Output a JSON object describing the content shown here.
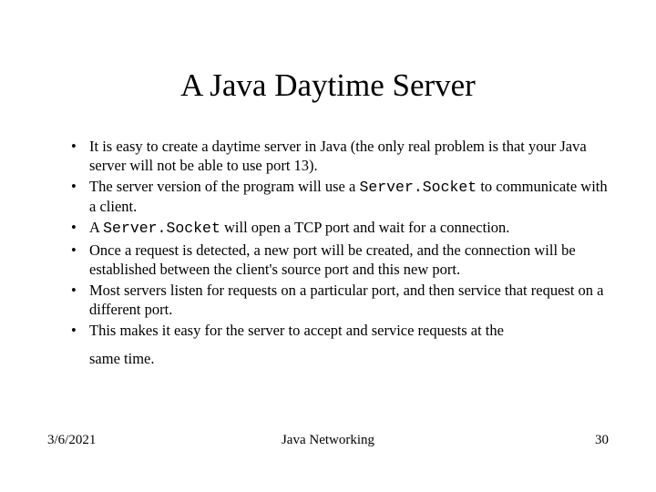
{
  "title": "A Java Daytime Server",
  "bullets": [
    {
      "pre": "It is easy to create a daytime server in Java (the only real problem is that your Java server will not be able to use port 13)."
    },
    {
      "pre": "The server version of the program will use a ",
      "code": "Server.Socket",
      "post": " to communicate with a client."
    },
    {
      "pre": "A ",
      "code": "Server.Socket",
      "post": " will open a TCP port and wait for a connection."
    },
    {
      "pre": "Once a request is detected, a new port will be created, and the connection will be established between the client's source port and this new port."
    },
    {
      "pre": "Most servers listen for requests on a particular port, and then service that request on a different port."
    },
    {
      "pre": "This makes it easy for the server to accept and service requests at the",
      "trail": "same time."
    }
  ],
  "footer": {
    "date": "3/6/2021",
    "topic": "Java Networking",
    "page": "30"
  }
}
